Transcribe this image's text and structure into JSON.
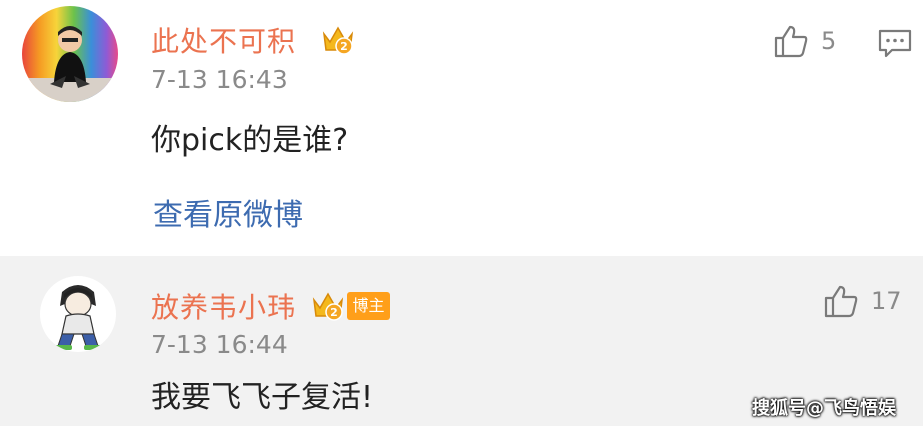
{
  "comments": [
    {
      "username": "此处不可积",
      "time": "7-13 16:43",
      "content": "你pick的是谁?",
      "likes": "5",
      "link": "查看原微博",
      "crown_level": "2"
    },
    {
      "username": "放养韦小玮",
      "badge": "博主",
      "time": "7-13 16:44",
      "content": "我要飞飞子复活!",
      "likes": "17",
      "crown_level": "2"
    }
  ],
  "watermark": "搜狐号@飞鸟悟娱",
  "colors": {
    "username": "#eb7350",
    "link": "#3d6bb0",
    "badge_bg": "#ff9f1a",
    "reply_bg": "#f2f2f2"
  },
  "icons": [
    "thumbs-up-icon",
    "comment-icon",
    "crown-icon"
  ]
}
